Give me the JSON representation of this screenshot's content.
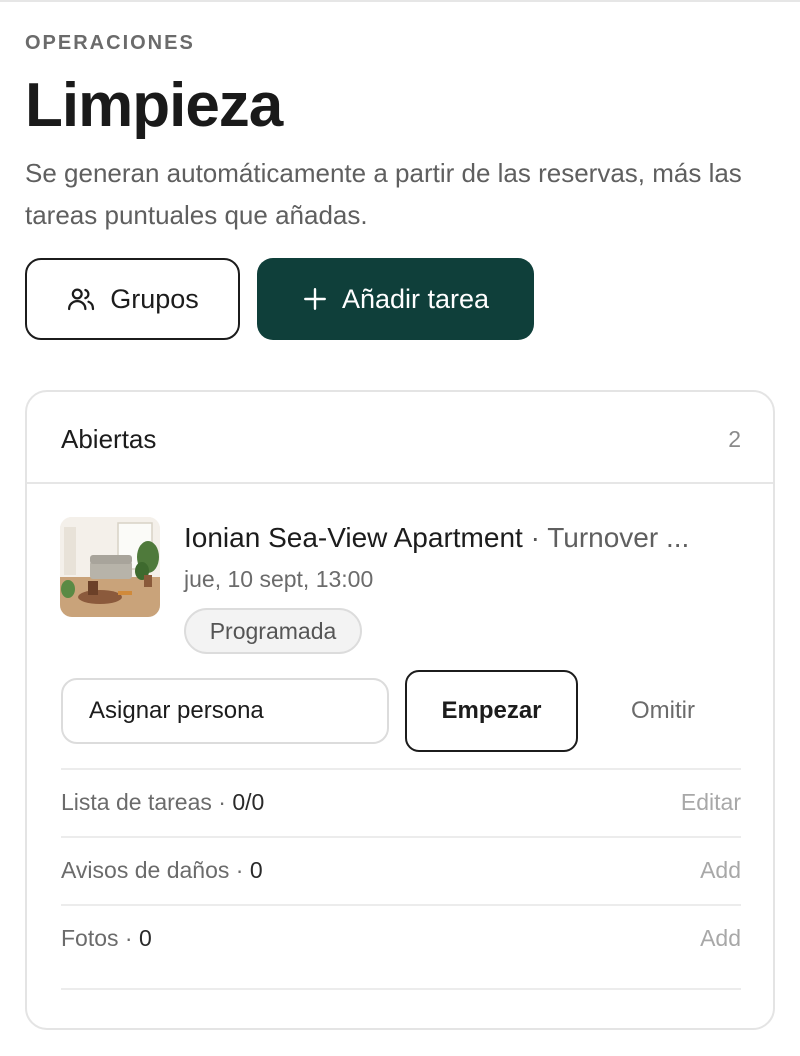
{
  "header": {
    "eyebrow": "OPERACIONES",
    "title": "Limpieza",
    "subtitle": "Se generan automáticamente a partir de las reservas, más las tareas puntuales que añadas."
  },
  "actions": {
    "groups_label": "Grupos",
    "groups_icon": "users-icon",
    "add_label": "Añadir tarea",
    "add_icon": "plus-icon",
    "add_color": "#0f3f3a"
  },
  "open_section": {
    "title": "Abiertas",
    "count": "2",
    "tasks": [
      {
        "property": "Ionian Sea-View Apartment",
        "separator": "·",
        "kind": "Turnover ...",
        "date": "jue, 10 sept, 13:00",
        "status": "Programada",
        "assign_label": "Asignar persona",
        "start_label": "Empezar",
        "skip_label": "Omitir",
        "rows": [
          {
            "label": "Lista de tareas",
            "value": "0/0",
            "action": "Editar"
          },
          {
            "label": "Avisos de daños",
            "value": "0",
            "action": "Add"
          },
          {
            "label": "Fotos",
            "value": "0",
            "action": "Add"
          }
        ]
      }
    ]
  }
}
